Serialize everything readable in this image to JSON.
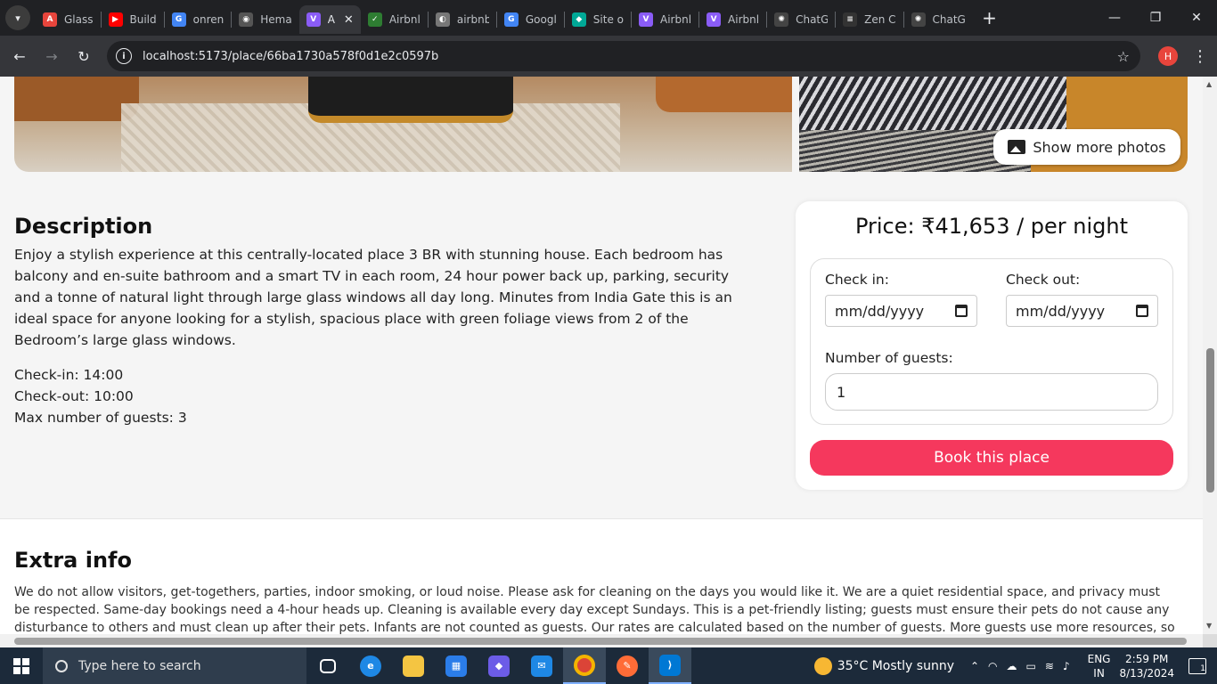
{
  "browser": {
    "tabs": [
      {
        "label": "Glass",
        "fav_color": "#e8453c",
        "fav_glyph": "A"
      },
      {
        "label": "Build",
        "fav_color": "#ff0000",
        "fav_glyph": "▶"
      },
      {
        "label": "onren",
        "fav_color": "#4285f4",
        "fav_glyph": "G"
      },
      {
        "label": "Hema",
        "fav_color": "#555555",
        "fav_glyph": "◉"
      },
      {
        "label": "A",
        "fav_color": "#8a5cf6",
        "fav_glyph": "V",
        "active": true
      },
      {
        "label": "Airbnl",
        "fav_color": "#2e7d32",
        "fav_glyph": "✓"
      },
      {
        "label": "airbnb",
        "fav_color": "#777777",
        "fav_glyph": "◐"
      },
      {
        "label": "Googl",
        "fav_color": "#4285f4",
        "fav_glyph": "G"
      },
      {
        "label": "Site o",
        "fav_color": "#00a896",
        "fav_glyph": "◆"
      },
      {
        "label": "Airbnl",
        "fav_color": "#8a5cf6",
        "fav_glyph": "V"
      },
      {
        "label": "Airbnl",
        "fav_color": "#8a5cf6",
        "fav_glyph": "V"
      },
      {
        "label": "ChatG",
        "fav_color": "#444444",
        "fav_glyph": "✺"
      },
      {
        "label": "Zen C",
        "fav_color": "#333333",
        "fav_glyph": "≡"
      },
      {
        "label": "ChatG",
        "fav_color": "#444444",
        "fav_glyph": "✺"
      }
    ],
    "url": "localhost:5173/place/66ba1730a578f0d1e2c0597b",
    "profile_initial": "H"
  },
  "place": {
    "show_more_label": "Show more photos",
    "description_heading": "Description",
    "description": "Enjoy a stylish experience at this centrally-located place 3 BR with stunning house. Each bedroom has balcony and en-suite bathroom and a smart TV in each room, 24 hour power back up, parking, security and a tonne of natural light through large glass windows all day long. Minutes from India Gate this is an ideal space for anyone looking for a stylish, spacious place with green foliage views from 2 of the Bedroom’s large glass windows.",
    "check_in": "Check-in: 14:00",
    "check_out": "Check-out: 10:00",
    "max_guests": "Max number of guests: 3",
    "extra_heading": "Extra info",
    "extra_text": "We do not allow visitors, get-togethers, parties, indoor smoking, or loud noise. Please ask for cleaning on the days you would like it. We are a quiet residential space, and privacy must be respected. Same-day bookings need a 4-hour heads up. Cleaning is available every day except Sundays. This is a pet-friendly listing; guests must ensure their pets do not cause any disturbance to others and must clean up after their pets. Infants are not counted as guests. Our rates are calculated based on the number of guests. More guests use more resources, so"
  },
  "booking": {
    "price": "Price: ₹41,653 / per night",
    "check_in_label": "Check in:",
    "check_out_label": "Check out:",
    "date_placeholder": "mm/dd/yyyy",
    "guests_label": "Number of guests:",
    "guests_value": "1",
    "book_label": "Book this place",
    "accent": "#f5385d"
  },
  "taskbar": {
    "search_placeholder": "Type here to search",
    "weather": "35°C  Mostly sunny",
    "lang_top": "ENG",
    "lang_bottom": "IN",
    "time": "2:59 PM",
    "date": "8/13/2024",
    "notification_count": "1"
  }
}
